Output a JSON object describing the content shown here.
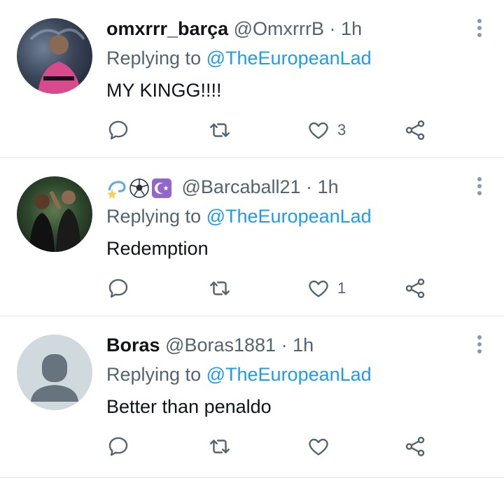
{
  "colors": {
    "accent": "#1d9bf0",
    "secondary_text": "#536471",
    "primary_text": "#0f1419",
    "divider": "#e3e6e9"
  },
  "tweets": [
    {
      "name": "omxrrr_barça",
      "handle": "@OmxrrrB",
      "separator": "·",
      "time": "1h",
      "replying_prefix": "Replying to",
      "replying_to": "@TheEuropeanLad",
      "text": "MY KINGG!!!!",
      "likes": "3",
      "avatar_icon": "player-photo-avatar"
    },
    {
      "name_emojis": [
        "dizzy-emoji",
        "soccer-ball-emoji",
        "star-and-crescent-emoji"
      ],
      "handle": "@Barcaball21",
      "separator": "·",
      "time": "1h",
      "replying_prefix": "Replying to",
      "replying_to": "@TheEuropeanLad",
      "text": "Redemption",
      "likes": "1",
      "avatar_icon": "players-photo-avatar"
    },
    {
      "name": "Boras",
      "handle": "@Boras1881",
      "separator": "·",
      "time": "1h",
      "replying_prefix": "Replying to",
      "replying_to": "@TheEuropeanLad",
      "text": "Better than penaldo",
      "likes": "",
      "avatar_icon": "default-profile-avatar"
    }
  ]
}
